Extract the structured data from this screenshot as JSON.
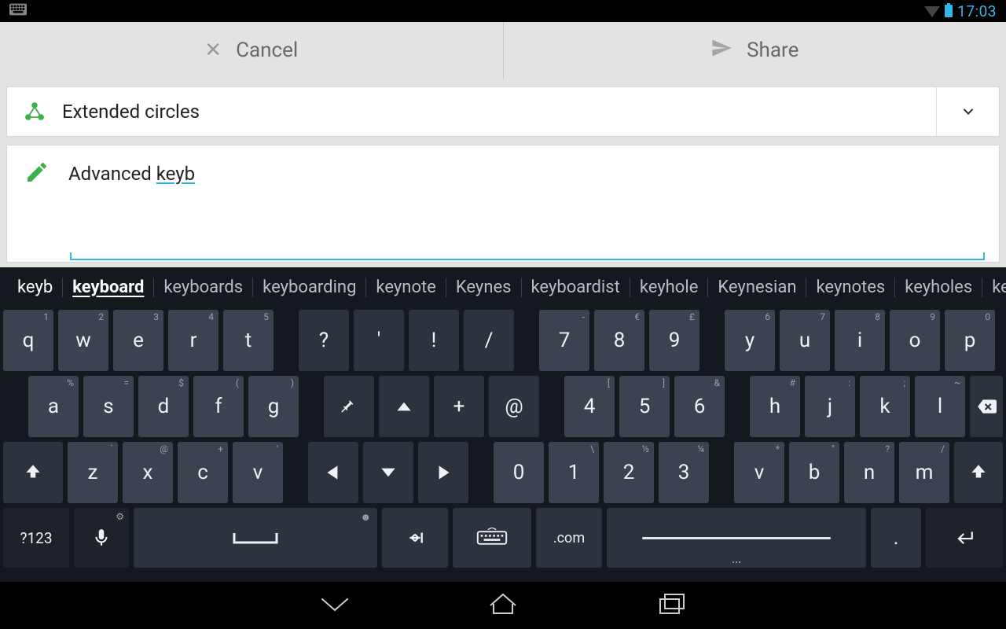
{
  "status": {
    "time": "17:03"
  },
  "actions": {
    "cancel": "Cancel",
    "share": "Share"
  },
  "audience": {
    "label": "Extended circles"
  },
  "compose": {
    "full_text": "Advanced keyb",
    "committed": "Advanced ",
    "typing": "keyb"
  },
  "suggestions": [
    "keyb",
    "keyboard",
    "keyboards",
    "keyboarding",
    "keynote",
    "Keynes",
    "keyboardist",
    "keyhole",
    "Keynesian",
    "keynotes",
    "keyholes",
    "ke"
  ],
  "keys": {
    "r1_left": [
      [
        "q",
        "1"
      ],
      [
        "w",
        "2"
      ],
      [
        "e",
        "3"
      ],
      [
        "r",
        "4"
      ],
      [
        "t",
        "5"
      ]
    ],
    "r1_mid": [
      [
        "?",
        ""
      ],
      [
        "'",
        ""
      ],
      [
        "!",
        ""
      ],
      [
        "/",
        ""
      ]
    ],
    "r1_num": [
      [
        "7",
        "-"
      ],
      [
        "8",
        "€"
      ],
      [
        "9",
        "£"
      ]
    ],
    "r1_right": [
      [
        "y",
        "6"
      ],
      [
        "u",
        "7"
      ],
      [
        "i",
        "8"
      ],
      [
        "o",
        "9"
      ],
      [
        "p",
        "0"
      ]
    ],
    "r2_left": [
      [
        "a",
        "%"
      ],
      [
        "s",
        "="
      ],
      [
        "d",
        "$"
      ],
      [
        "f",
        "("
      ],
      [
        "g",
        ")"
      ]
    ],
    "r2_mid": [
      [
        "pin",
        ""
      ],
      [
        "up",
        ""
      ],
      [
        "+",
        ""
      ],
      [
        "@",
        ""
      ]
    ],
    "r2_num": [
      [
        "4",
        "["
      ],
      [
        "5",
        "]"
      ],
      [
        "6",
        "&"
      ]
    ],
    "r2_right": [
      [
        "h",
        "#"
      ],
      [
        "j",
        ":"
      ],
      [
        "k",
        ";"
      ],
      [
        "l",
        "~"
      ]
    ],
    "r3_left": [
      [
        "z",
        "`"
      ],
      [
        "x",
        "@"
      ],
      [
        "c",
        "+"
      ],
      [
        "v",
        "'"
      ]
    ],
    "r3_mid": [
      [
        "left",
        ""
      ],
      [
        "down",
        ""
      ],
      [
        "right",
        ""
      ]
    ],
    "r3_num": [
      [
        "0",
        ""
      ],
      [
        "1",
        "\\"
      ],
      [
        "2",
        "½"
      ],
      [
        "3",
        "¼"
      ]
    ],
    "r3_right": [
      [
        "v",
        "*"
      ],
      [
        "b",
        "\""
      ],
      [
        "n",
        "?"
      ],
      [
        "m",
        "/"
      ]
    ],
    "bottom": {
      "sym": "?123",
      "dotcom": ".com",
      "period": "."
    }
  }
}
